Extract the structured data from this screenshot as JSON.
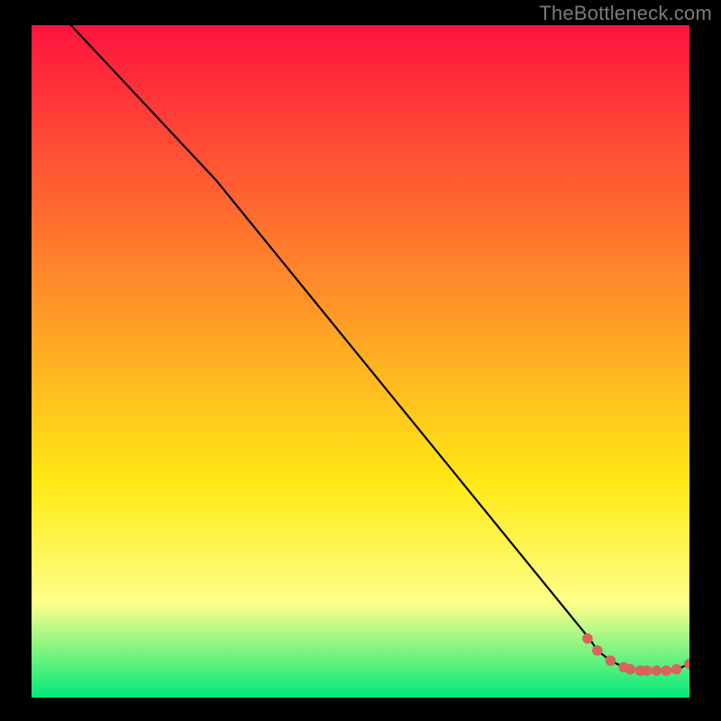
{
  "watermark": "TheBottleneck.com",
  "colors": {
    "gradient_top": "#ff143e",
    "gradient_mid1": "#ff8a2a",
    "gradient_mid2": "#ffe915",
    "gradient_mid3": "#feff8a",
    "gradient_bottom": "#00e878",
    "line": "#000000",
    "marker": "#d9645b",
    "frame": "#000000"
  },
  "chart_data": {
    "type": "line",
    "title": "",
    "xlabel": "",
    "ylabel": "",
    "xlim": [
      0,
      100
    ],
    "ylim": [
      0,
      100
    ],
    "series": [
      {
        "name": "curve",
        "x": [
          6,
          28,
          85,
          86,
          88,
          90,
          91,
          92.5,
          93.5,
          95,
          96.5,
          98,
          100
        ],
        "y": [
          100,
          77,
          8.5,
          7,
          5.5,
          4.5,
          4.2,
          4,
          4,
          4,
          4,
          4.2,
          5
        ]
      }
    ],
    "markers": {
      "name": "highlight-points",
      "x": [
        84.5,
        86,
        88,
        90,
        91,
        92.5,
        93.5,
        95,
        96.5,
        98,
        100
      ],
      "y": [
        8.8,
        7,
        5.5,
        4.5,
        4.2,
        4,
        4,
        4,
        4,
        4.2,
        5
      ]
    }
  }
}
